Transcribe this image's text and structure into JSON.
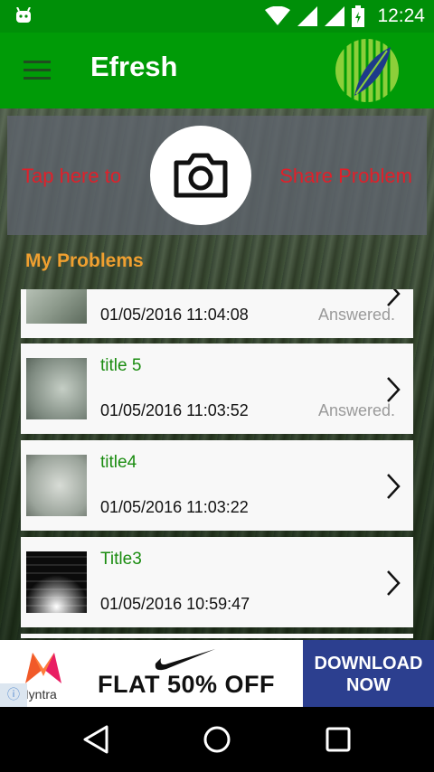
{
  "status_bar": {
    "time": "12:24"
  },
  "app": {
    "title": "Efresh"
  },
  "share": {
    "tap_text": "Tap here to",
    "share_text": "Share Problem"
  },
  "section": {
    "title": "My Problems"
  },
  "problems": [
    {
      "title": "",
      "date": "01/05/2016 11:04:08",
      "status": "Answered."
    },
    {
      "title": "title 5",
      "date": "01/05/2016 11:03:52",
      "status": "Answered."
    },
    {
      "title": "title4",
      "date": "01/05/2016 11:03:22",
      "status": ""
    },
    {
      "title": "Title3",
      "date": "01/05/2016 10:59:47",
      "status": ""
    }
  ],
  "ad": {
    "brand": "Myntra",
    "offer": "FLAT 50% OFF",
    "cta_line1": "DOWNLOAD",
    "cta_line2": "NOW"
  },
  "colors": {
    "primary": "#009b07",
    "status_bar": "#008f08",
    "section": "#f0a030",
    "share_text": "#e0202a",
    "item_title": "#1a8c10"
  }
}
